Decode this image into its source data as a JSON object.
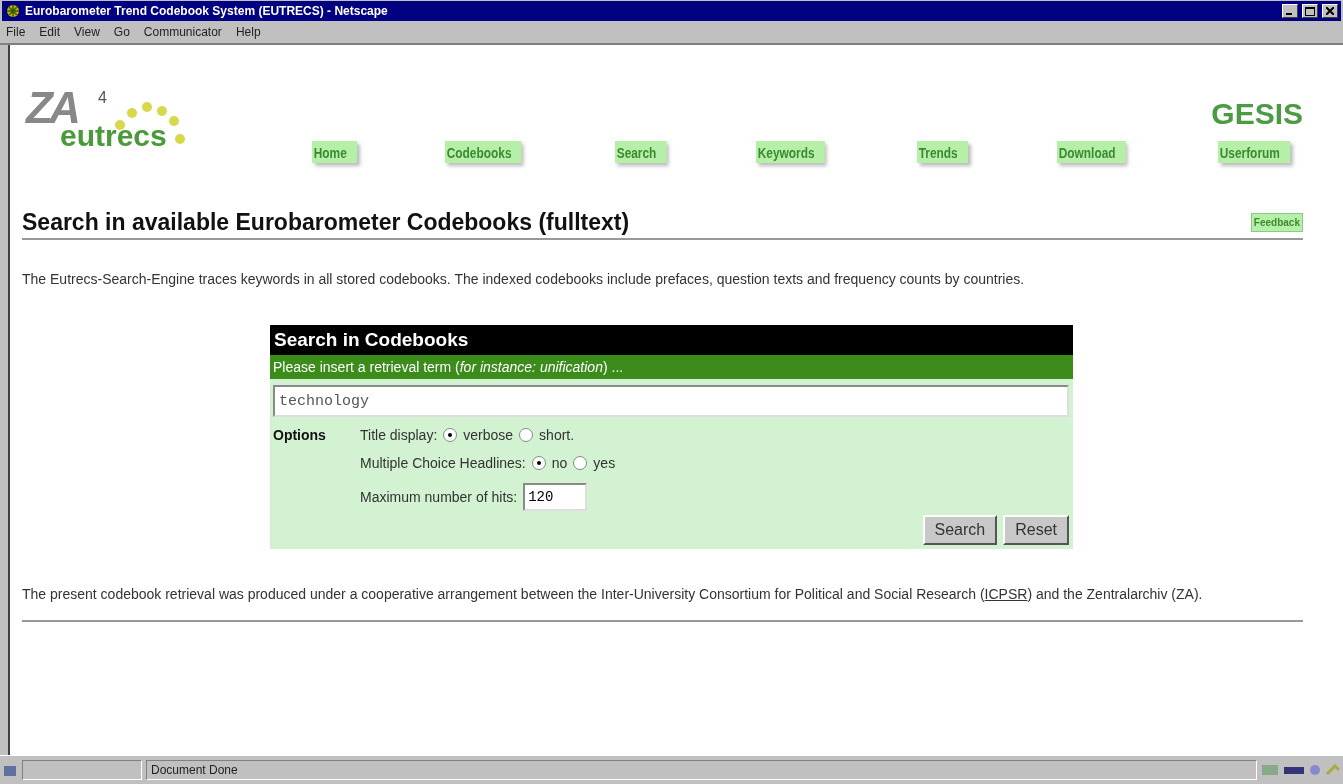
{
  "window": {
    "title": "Eurobarometer Trend Codebook System (EUTRECS) - Netscape"
  },
  "menu": [
    "File",
    "Edit",
    "View",
    "Go",
    "Communicator",
    "Help"
  ],
  "logo": {
    "letters": "ZA",
    "digit": "4",
    "name": "eutrecs"
  },
  "brand": "GESIS",
  "nav": [
    "Home",
    "Codebooks",
    "Search",
    "Keywords",
    "Trends",
    "Download",
    "Userforum"
  ],
  "heading": "Search in available Eurobarometer Codebooks (fulltext)",
  "feedback": "Feedback",
  "intro": "The Eutrecs-Search-Engine traces keywords in all stored codebooks. The indexed codebooks include prefaces, question texts and frequency counts by countries.",
  "form": {
    "title": "Search in Codebooks",
    "prompt": "Please insert a retrieval term (*for instance:* *unification*) ...",
    "query": "technology",
    "options_label": "Options",
    "title_display": {
      "label": "Title display:",
      "choices": [
        {
          "label": "verbose",
          "selected": true
        },
        {
          "label": "short.",
          "selected": false
        }
      ]
    },
    "headlines": {
      "label": "Multiple Choice Headlines:",
      "choices": [
        {
          "label": "no",
          "selected": true
        },
        {
          "label": "yes",
          "selected": false
        }
      ]
    },
    "max_hits": {
      "label": "Maximum number of hits:",
      "value": "120"
    },
    "buttons": [
      "Search",
      "Reset"
    ]
  },
  "footer": {
    "before": "The present codebook retrieval was produced under a cooperative arrangement between the Inter-University Consortium for Political and Social Research (",
    "link": "ICPSR",
    "after": ") and the Zentralarchiv (ZA)."
  },
  "status_bar": {
    "text": "Document Done"
  }
}
